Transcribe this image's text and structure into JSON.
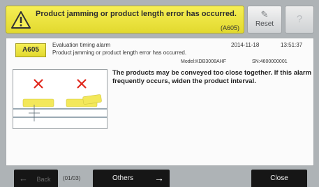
{
  "alert_bar": {
    "message": "Product jamming or product length error has occurred.",
    "code": "(A605)"
  },
  "toolbar": {
    "reset_label": "Reset",
    "reset_icon": "eraser-icon",
    "help_icon": "question-icon"
  },
  "alarm": {
    "code": "A605",
    "type": "Evaluation timing alarm",
    "message": "Product jamming or product length error has occurred.",
    "date": "2014-11-18",
    "time": "13:51:37",
    "model": "Model:KDB3008AHF",
    "serial": "SN:4600000001",
    "description": "The products may be conveyed too close together. If this alarm frequently occurs, widen the product interval."
  },
  "nav": {
    "back_label": "Back",
    "page_indicator": "(01/03)",
    "others_label": "Others",
    "close_label": "Close"
  },
  "colors": {
    "alert_yellow": "#f0e84a",
    "error_red": "#e0281e",
    "button_dark": "#161616"
  }
}
